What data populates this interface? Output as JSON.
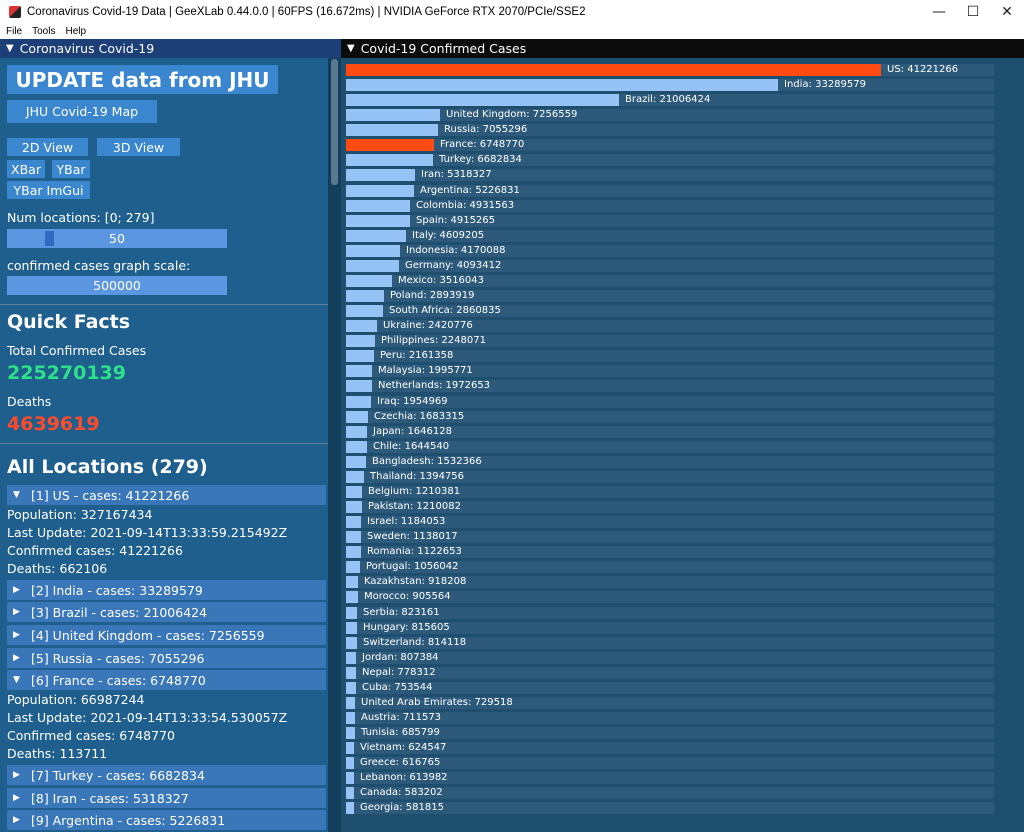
{
  "window": {
    "title": "Coronavirus Covid-19 Data | GeeXLab 0.44.0.0 | 60FPS (16.672ms) | NVIDIA GeForce RTX 2070/PCIe/SSE2",
    "minimize": "—",
    "maximize": "☐",
    "close": "✕"
  },
  "menu": [
    "File",
    "Tools",
    "Help"
  ],
  "left": {
    "header": "Coronavirus Covid-19",
    "update_button": "UPDATE data from JHU",
    "map_button": "JHU Covid-19 Map",
    "view2d_button": "2D View",
    "view3d_button": "3D View",
    "xbar_button": "XBar",
    "ybar_button": "YBar",
    "ybar_imgui_button": "YBar ImGui",
    "num_locations_label": "Num locations: [0; 279]",
    "num_locations_value": "50",
    "num_locations_fraction": 0.179,
    "scale_label": "confirmed cases graph scale:",
    "scale_value": "500000",
    "quick_facts": "Quick Facts",
    "total_cases_label": "Total Confirmed Cases",
    "total_cases_value": "225270139",
    "deaths_label": "Deaths",
    "deaths_value": "4639619",
    "all_locations": "All Locations (279)",
    "us": {
      "title": "[1] US - cases: 41221266",
      "population": "Population: 327167434",
      "last_update": "Last Update: 2021-09-14T13:33:59.215492Z",
      "confirmed": "Confirmed cases: 41221266",
      "deaths": "Deaths: 662106"
    },
    "collapsed_a": [
      "[2] India - cases: 33289579",
      "[3] Brazil - cases: 21006424",
      "[4] United Kingdom - cases: 7256559",
      "[5] Russia - cases: 7055296"
    ],
    "france": {
      "title": "[6] France - cases: 6748770",
      "population": "Population: 66987244",
      "last_update": "Last Update: 2021-09-14T13:33:54.530057Z",
      "confirmed": "Confirmed cases: 6748770",
      "deaths": "Deaths: 113711"
    },
    "collapsed_b": [
      "[7] Turkey - cases: 6682834",
      "[8] Iran - cases: 5318327",
      "[9] Argentina - cases: 5226831"
    ]
  },
  "chart_header": "Covid-19 Confirmed Cases",
  "chart_data": {
    "type": "bar",
    "orientation": "horizontal",
    "highlighted": [
      "US",
      "France"
    ],
    "highlight_color": "#ff4a12",
    "bar_color": "#95c3f5",
    "categories": [
      "US",
      "India",
      "Brazil",
      "United Kingdom",
      "Russia",
      "France",
      "Turkey",
      "Iran",
      "Argentina",
      "Colombia",
      "Spain",
      "Italy",
      "Indonesia",
      "Germany",
      "Mexico",
      "Poland",
      "South Africa",
      "Ukraine",
      "Philippines",
      "Peru",
      "Malaysia",
      "Netherlands",
      "Iraq",
      "Czechia",
      "Japan",
      "Chile",
      "Bangladesh",
      "Thailand",
      "Belgium",
      "Pakistan",
      "Israel",
      "Sweden",
      "Romania",
      "Portugal",
      "Kazakhstan",
      "Morocco",
      "Serbia",
      "Hungary",
      "Switzerland",
      "Jordan",
      "Nepal",
      "Cuba",
      "United Arab Emirates",
      "Austria",
      "Tunisia",
      "Vietnam",
      "Greece",
      "Lebanon",
      "Canada",
      "Georgia"
    ],
    "values": [
      41221266,
      33289579,
      21006424,
      7256559,
      7055296,
      6748770,
      6682834,
      5318327,
      5226831,
      4931563,
      4915265,
      4609205,
      4170088,
      4093412,
      3516043,
      2893919,
      2860835,
      2420776,
      2248071,
      2161358,
      1995771,
      1972653,
      1954969,
      1683315,
      1646128,
      1644540,
      1532366,
      1394756,
      1210381,
      1210082,
      1184053,
      1138017,
      1122653,
      1056042,
      918208,
      905564,
      823161,
      815605,
      814118,
      807384,
      778312,
      753544,
      729518,
      711573,
      685799,
      624547,
      616765,
      613982,
      583202,
      581815
    ]
  }
}
